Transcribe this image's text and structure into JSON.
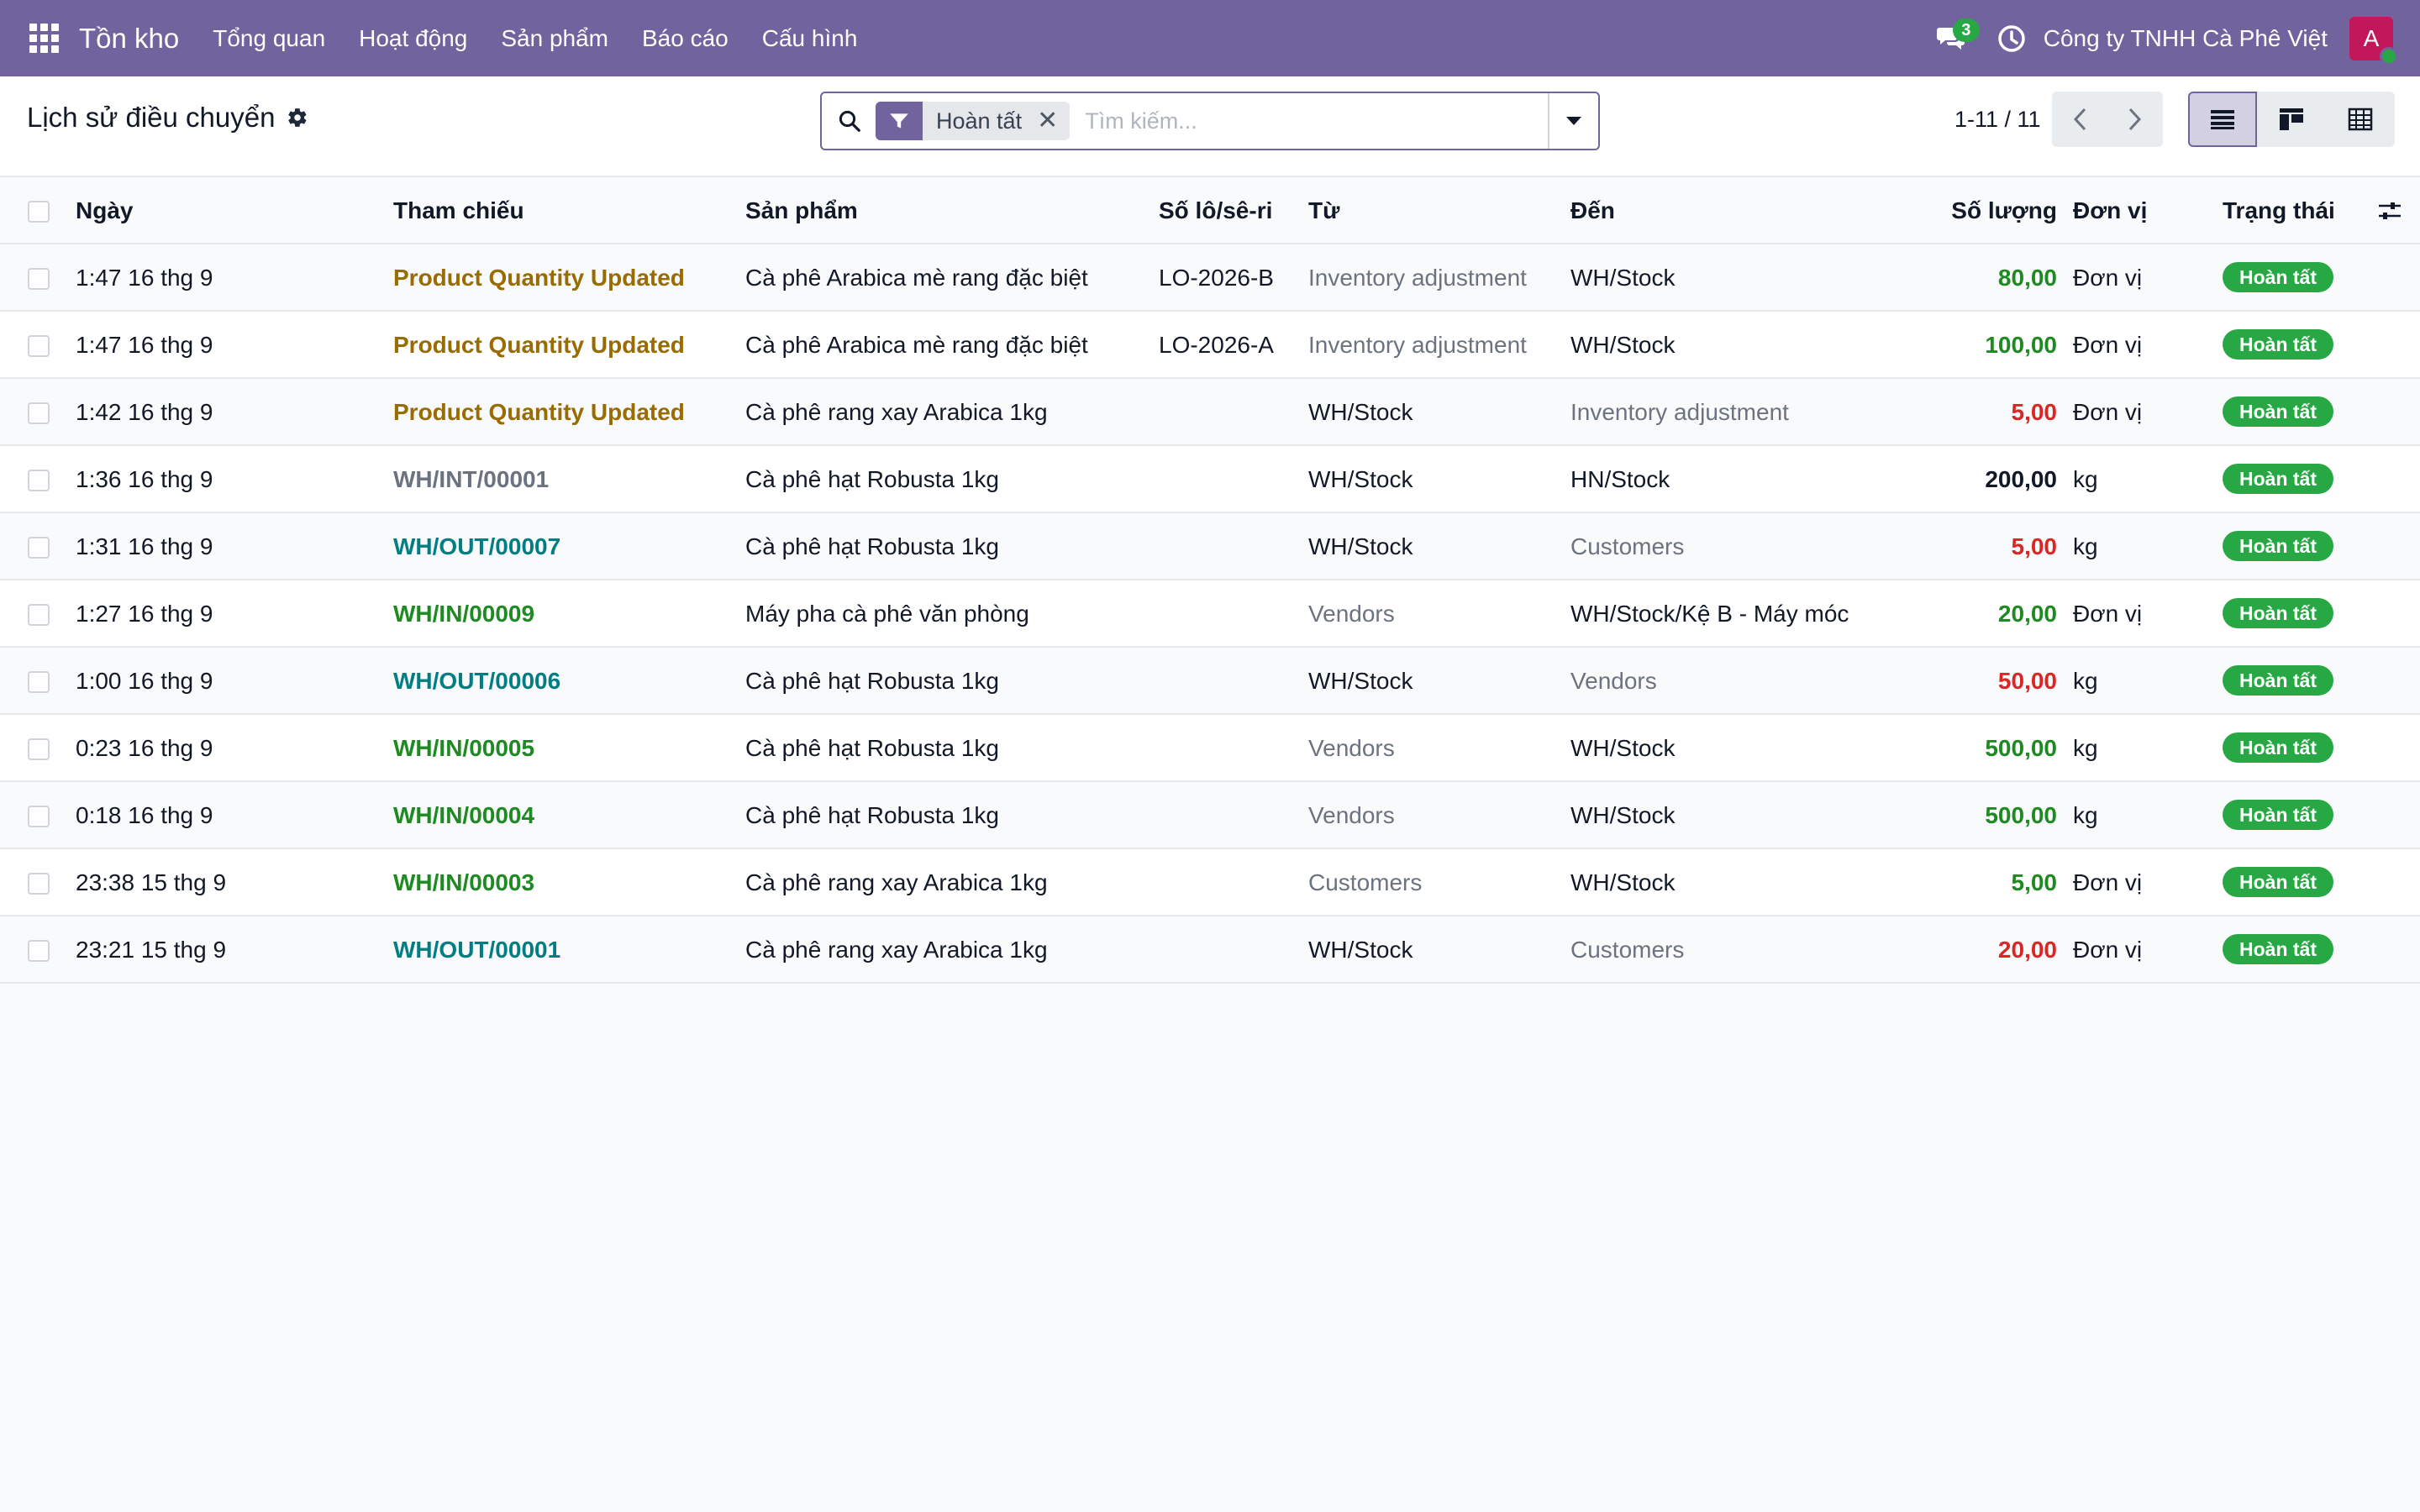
{
  "navbar": {
    "brand": "Tồn kho",
    "menu": [
      "Tổng quan",
      "Hoạt động",
      "Sản phẩm",
      "Báo cáo",
      "Cấu hình"
    ],
    "messages_count": "3",
    "company": "Công ty TNHH Cà Phê Việt",
    "avatar_initial": "A",
    "color": "#71639e"
  },
  "control": {
    "title": "Lịch sử điều chuyển",
    "facet_label": "Hoàn tất",
    "search_placeholder": "Tìm kiếm...",
    "pager": "1-11 / 11"
  },
  "table": {
    "headers": {
      "date": "Ngày",
      "reference": "Tham chiếu",
      "product": "Sản phẩm",
      "lot": "Số lô/sê-ri",
      "from": "Từ",
      "to": "Đến",
      "quantity": "Số lượng",
      "uom": "Đơn vị",
      "state": "Trạng thái"
    },
    "rows": [
      {
        "date": "1:47 16 thg 9",
        "reference": "Product Quantity Updated",
        "ref_color": "#9a6b00",
        "product": "Cà phê Arabica mè rang đặc biệt",
        "lot": "LO-2026-B",
        "from": "Inventory adjustment",
        "from_muted": true,
        "to": "WH/Stock",
        "to_muted": false,
        "quantity": "80,00",
        "qty_color": "#1e8a22",
        "uom": "Đơn vị",
        "state": "Hoàn tất"
      },
      {
        "date": "1:47 16 thg 9",
        "reference": "Product Quantity Updated",
        "ref_color": "#9a6b00",
        "product": "Cà phê Arabica mè rang đặc biệt",
        "lot": "LO-2026-A",
        "from": "Inventory adjustment",
        "from_muted": true,
        "to": "WH/Stock",
        "to_muted": false,
        "quantity": "100,00",
        "qty_color": "#1e8a22",
        "uom": "Đơn vị",
        "state": "Hoàn tất"
      },
      {
        "date": "1:42 16 thg 9",
        "reference": "Product Quantity Updated",
        "ref_color": "#9a6b00",
        "product": "Cà phê rang xay Arabica 1kg",
        "lot": "",
        "from": "WH/Stock",
        "from_muted": false,
        "to": "Inventory adjustment",
        "to_muted": true,
        "quantity": "5,00",
        "qty_color": "#dc2626",
        "uom": "Đơn vị",
        "state": "Hoàn tất"
      },
      {
        "date": "1:36 16 thg 9",
        "reference": "WH/INT/00001",
        "ref_color": "#6b7280",
        "product": "Cà phê hạt Robusta 1kg",
        "lot": "",
        "from": "WH/Stock",
        "from_muted": false,
        "to": "HN/Stock",
        "to_muted": false,
        "quantity": "200,00",
        "qty_color": "#111827",
        "uom": "kg",
        "state": "Hoàn tất"
      },
      {
        "date": "1:31 16 thg 9",
        "reference": "WH/OUT/00007",
        "ref_color": "#017e84",
        "product": "Cà phê hạt Robusta 1kg",
        "lot": "",
        "from": "WH/Stock",
        "from_muted": false,
        "to": "Customers",
        "to_muted": true,
        "quantity": "5,00",
        "qty_color": "#dc2626",
        "uom": "kg",
        "state": "Hoàn tất"
      },
      {
        "date": "1:27 16 thg 9",
        "reference": "WH/IN/00009",
        "ref_color": "#1e8a22",
        "product": "Máy pha cà phê văn phòng",
        "lot": "",
        "from": "Vendors",
        "from_muted": true,
        "to": "WH/Stock/Kệ B - Máy móc",
        "to_muted": false,
        "quantity": "20,00",
        "qty_color": "#1e8a22",
        "uom": "Đơn vị",
        "state": "Hoàn tất"
      },
      {
        "date": "1:00 16 thg 9",
        "reference": "WH/OUT/00006",
        "ref_color": "#017e84",
        "product": "Cà phê hạt Robusta 1kg",
        "lot": "",
        "from": "WH/Stock",
        "from_muted": false,
        "to": "Vendors",
        "to_muted": true,
        "quantity": "50,00",
        "qty_color": "#dc2626",
        "uom": "kg",
        "state": "Hoàn tất"
      },
      {
        "date": "0:23 16 thg 9",
        "reference": "WH/IN/00005",
        "ref_color": "#1e8a22",
        "product": "Cà phê hạt Robusta 1kg",
        "lot": "",
        "from": "Vendors",
        "from_muted": true,
        "to": "WH/Stock",
        "to_muted": false,
        "quantity": "500,00",
        "qty_color": "#1e8a22",
        "uom": "kg",
        "state": "Hoàn tất"
      },
      {
        "date": "0:18 16 thg 9",
        "reference": "WH/IN/00004",
        "ref_color": "#1e8a22",
        "product": "Cà phê hạt Robusta 1kg",
        "lot": "",
        "from": "Vendors",
        "from_muted": true,
        "to": "WH/Stock",
        "to_muted": false,
        "quantity": "500,00",
        "qty_color": "#1e8a22",
        "uom": "kg",
        "state": "Hoàn tất"
      },
      {
        "date": "23:38 15 thg 9",
        "reference": "WH/IN/00003",
        "ref_color": "#1e8a22",
        "product": "Cà phê rang xay Arabica 1kg",
        "lot": "",
        "from": "Customers",
        "from_muted": true,
        "to": "WH/Stock",
        "to_muted": false,
        "quantity": "5,00",
        "qty_color": "#1e8a22",
        "uom": "Đơn vị",
        "state": "Hoàn tất"
      },
      {
        "date": "23:21 15 thg 9",
        "reference": "WH/OUT/00001",
        "ref_color": "#017e84",
        "product": "Cà phê rang xay Arabica 1kg",
        "lot": "",
        "from": "WH/Stock",
        "from_muted": false,
        "to": "Customers",
        "to_muted": true,
        "quantity": "20,00",
        "qty_color": "#dc2626",
        "uom": "Đơn vị",
        "state": "Hoàn tất"
      }
    ]
  }
}
